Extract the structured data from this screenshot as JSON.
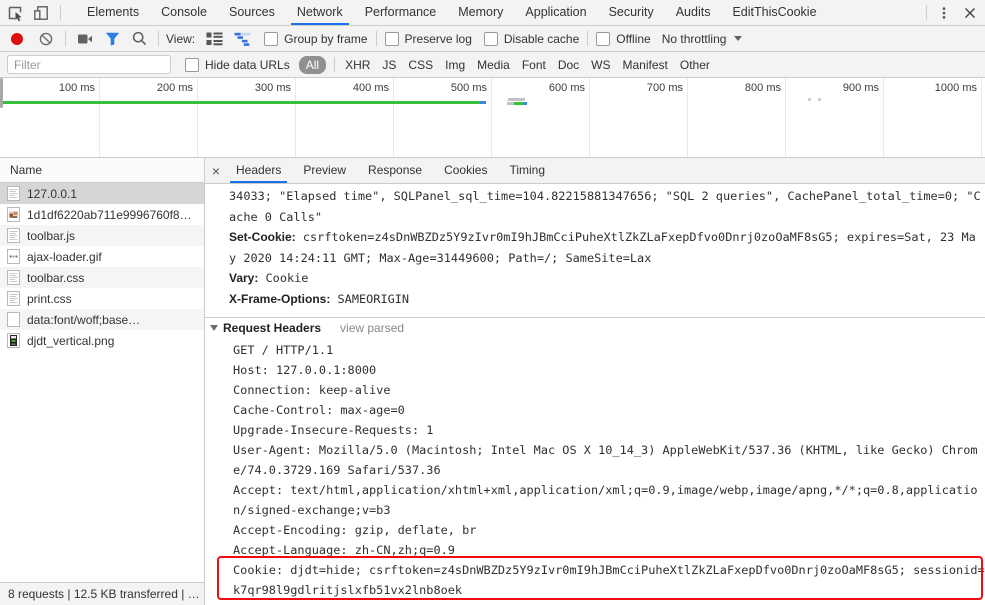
{
  "window": {
    "tabs": [
      "Elements",
      "Console",
      "Sources",
      "Network",
      "Performance",
      "Memory",
      "Application",
      "Security",
      "Audits",
      "EditThisCookie"
    ],
    "selected_tab": "Network",
    "accent_color": "#1a73e8"
  },
  "toolbar": {
    "view_label": "View:",
    "checkboxes": [
      "Group by frame",
      "Preserve log",
      "Disable cache",
      "Offline"
    ],
    "throttling": "No throttling"
  },
  "filter_bar": {
    "placeholder": "Filter",
    "hide_data_urls": "Hide data URLs",
    "filters": [
      "All",
      "XHR",
      "JS",
      "CSS",
      "Img",
      "Media",
      "Font",
      "Doc",
      "WS",
      "Manifest",
      "Other"
    ],
    "selected_filter": "All"
  },
  "overview": {
    "ticks": [
      "100 ms",
      "200 ms",
      "300 ms",
      "400 ms",
      "500 ms",
      "600 ms",
      "700 ms",
      "800 ms",
      "900 ms",
      "1000 ms"
    ],
    "colors": {
      "green": "#35c13a",
      "blue": "#3588e8",
      "grey": "#c3c3c3"
    }
  },
  "requests": {
    "header": "Name",
    "rows": [
      {
        "name": "127.0.0.1",
        "icon": "document-icon",
        "selected": true
      },
      {
        "name": "1d1df6220ab711e9996760f8…",
        "icon": "image-icon"
      },
      {
        "name": "toolbar.js",
        "icon": "script-icon"
      },
      {
        "name": "ajax-loader.gif",
        "icon": "gif-image-icon"
      },
      {
        "name": "toolbar.css",
        "icon": "stylesheet-icon"
      },
      {
        "name": "print.css",
        "icon": "stylesheet-icon"
      },
      {
        "name": "data:font/woff;base…",
        "icon": "font-data-icon"
      },
      {
        "name": "djdt_vertical.png",
        "icon": "png-image-icon"
      }
    ]
  },
  "status_bar": {
    "text": "8 requests | 12.5 KB transferred | …"
  },
  "detail": {
    "tabs": [
      "Headers",
      "Preview",
      "Response",
      "Cookies",
      "Timing"
    ],
    "selected_tab": "Headers",
    "close_label": "×",
    "response_lines": [
      {
        "t": "34033; \"Elapsed time\", SQLPanel_sql_time=104.82215881347656; \"SQL 2 queries\", CachePanel_total_time=0; \"C"
      },
      {
        "t": "ache 0 Calls\""
      },
      {
        "b": "Set-Cookie:",
        "t": " csrftoken=z4sDnWBZDz5Y9zIvr0mI9hJBmCciPuheXtlZkZLaFxepDfvo0Dnrj0zoOaMF8sG5; expires=Sat, 23 Ma"
      },
      {
        "t": "y 2020 14:24:11 GMT; Max-Age=31449600; Path=/; SameSite=Lax"
      },
      {
        "b": "Vary:",
        "t": " Cookie"
      },
      {
        "b": "X-Frame-Options:",
        "t": " SAMEORIGIN"
      }
    ],
    "request_headers": {
      "title": "Request Headers",
      "action": "view parsed",
      "raw_lines": [
        "GET / HTTP/1.1",
        "Host: 127.0.0.1:8000",
        "Connection: keep-alive",
        "Cache-Control: max-age=0",
        "Upgrade-Insecure-Requests: 1",
        "User-Agent: Mozilla/5.0 (Macintosh; Intel Mac OS X 10_14_3) AppleWebKit/537.36 (KHTML, like Gecko) Chrom",
        "e/74.0.3729.169 Safari/537.36",
        "Accept: text/html,application/xhtml+xml,application/xml;q=0.9,image/webp,image/apng,*/*;q=0.8,applicatio",
        "n/signed-exchange;v=b3",
        "Accept-Encoding: gzip, deflate, br",
        "Accept-Language: zh-CN,zh;q=0.9",
        "Cookie: djdt=hide; csrftoken=z4sDnWBZDz5Y9zIvr0mI9hJBmCciPuheXtlZkZLaFxepDfvo0Dnrj0zoOaMF8sG5; sessionid=",
        "k7qr98l9gdlritjslxfb51vx2lnb8oek"
      ]
    },
    "annotation": {
      "highlight_color": "#ee0c0c"
    }
  }
}
